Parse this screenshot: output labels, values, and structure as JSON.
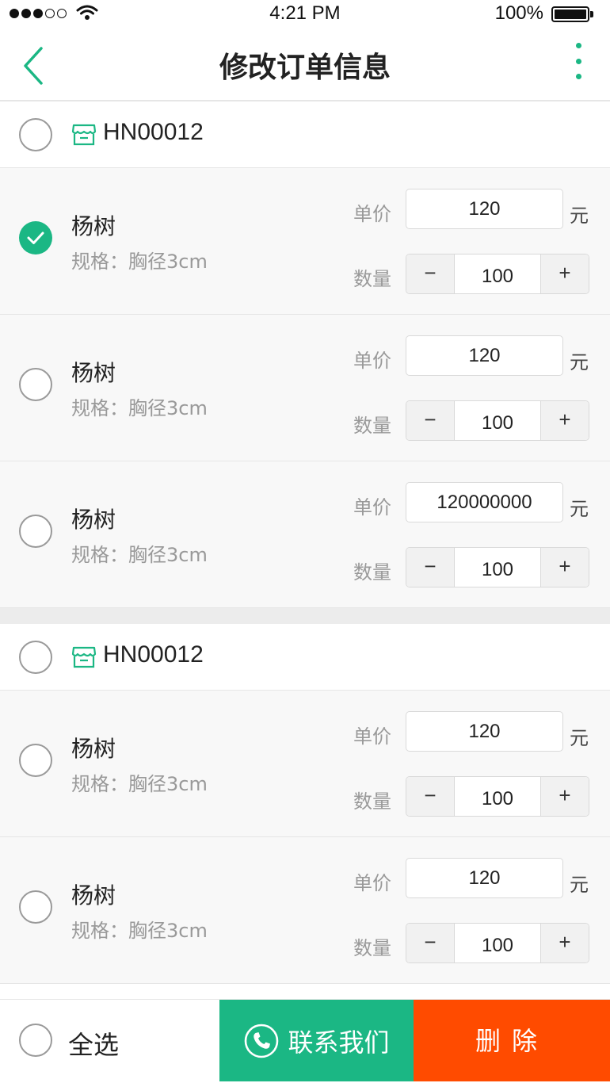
{
  "status_bar": {
    "time": "4:21 PM",
    "battery": "100%"
  },
  "header": {
    "title": "修改订单信息"
  },
  "labels": {
    "price": "单价",
    "qty": "数量",
    "yuan": "元",
    "minus": "−",
    "plus": "+"
  },
  "groups": [
    {
      "shop_code": "HN00012",
      "items": [
        {
          "name": "杨树",
          "spec": "规格：胸径3cm",
          "price": "120",
          "qty": "100",
          "checked": true
        },
        {
          "name": "杨树",
          "spec": "规格：胸径3cm",
          "price": "120",
          "qty": "100",
          "checked": false
        },
        {
          "name": "杨树",
          "spec": "规格：胸径3cm",
          "price": "120000000",
          "qty": "100",
          "checked": false
        }
      ]
    },
    {
      "shop_code": "HN00012",
      "items": [
        {
          "name": "杨树",
          "spec": "规格：胸径3cm",
          "price": "120",
          "qty": "100",
          "checked": false
        },
        {
          "name": "杨树",
          "spec": "规格：胸径3cm",
          "price": "120",
          "qty": "100",
          "checked": false
        }
      ]
    }
  ],
  "bottom_bar": {
    "select_all": "全选",
    "contact": "联系我们",
    "delete": "删除"
  },
  "colors": {
    "accent_green": "#1bb784",
    "danger_orange": "#ff4b00"
  },
  "icons": {
    "back": "chevron-left-icon",
    "more": "more-vertical-icon",
    "shop": "store-icon",
    "phone": "phone-icon",
    "check": "check-icon"
  }
}
